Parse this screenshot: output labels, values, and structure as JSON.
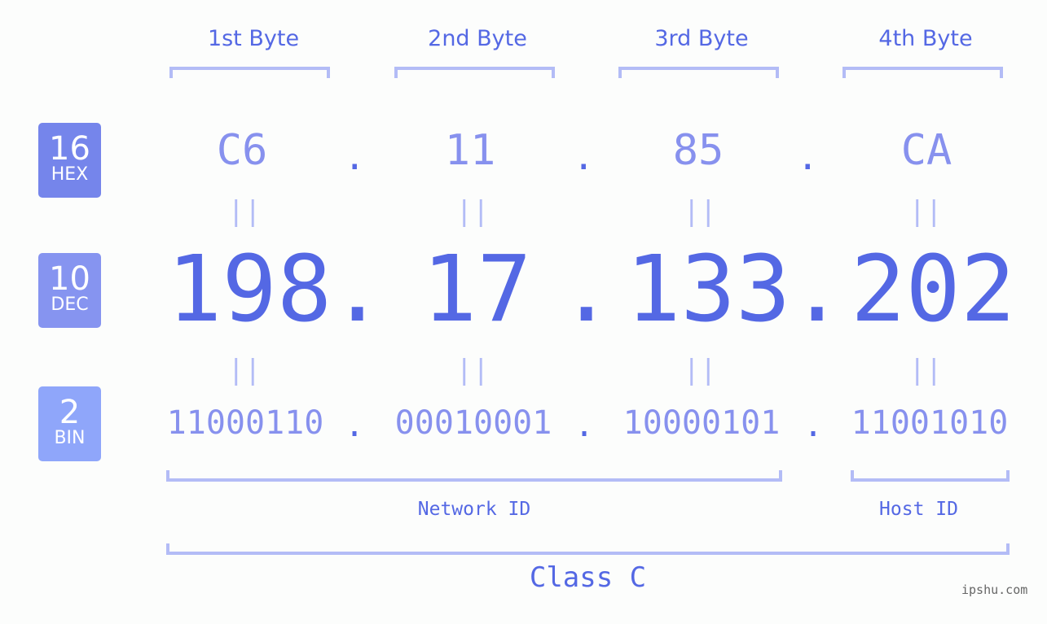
{
  "byte_headers": [
    "1st Byte",
    "2nd Byte",
    "3rd Byte",
    "4th Byte"
  ],
  "badges": [
    {
      "number": "16",
      "label": "HEX",
      "color": "#7585eb"
    },
    {
      "number": "10",
      "label": "DEC",
      "color": "#8694f0"
    },
    {
      "number": "2",
      "label": "BIN",
      "color": "#8fa6fa"
    }
  ],
  "hex": [
    "C6",
    "11",
    "85",
    "CA"
  ],
  "dec": [
    "198",
    "17",
    "133",
    "202"
  ],
  "bin": [
    "11000110",
    "00010001",
    "10000101",
    "11001010"
  ],
  "separator": ".",
  "equals": "||",
  "network_id_label": "Network ID",
  "host_id_label": "Host ID",
  "class_label": "Class C",
  "watermark": "ipshu.com",
  "colors": {
    "primary": "#5468e4",
    "light": "#8791ee",
    "bracket": "#b3bcf6"
  }
}
